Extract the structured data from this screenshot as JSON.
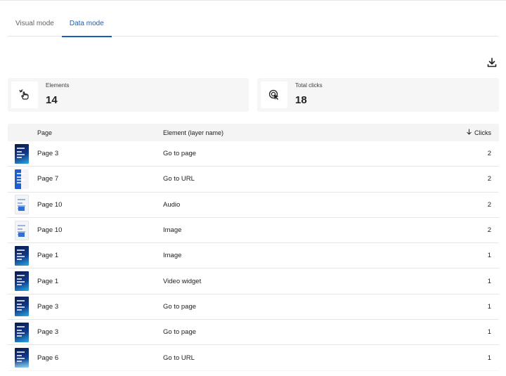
{
  "tabs": [
    {
      "label": "Visual mode",
      "active": false
    },
    {
      "label": "Data mode",
      "active": true
    }
  ],
  "download_icon": "download-icon",
  "stats": {
    "elements": {
      "label": "Elements",
      "value": "14",
      "icon": "tap-gesture-icon"
    },
    "total_clicks": {
      "label": "Total clicks",
      "value": "18",
      "icon": "click-cursor-icon"
    }
  },
  "table": {
    "headers": {
      "page": "Page",
      "element": "Element (layer name)",
      "clicks": "Clicks"
    },
    "sort": {
      "column": "clicks",
      "direction": "descending",
      "icon": "arrow-down-icon"
    },
    "rows": [
      {
        "thumb": "dark",
        "page": "Page 3",
        "element": "Go to page",
        "clicks": "2"
      },
      {
        "thumb": "dark-side",
        "page": "Page 7",
        "element": "Go to URL",
        "clicks": "2"
      },
      {
        "thumb": "light",
        "page": "Page 10",
        "element": "Audio",
        "clicks": "2"
      },
      {
        "thumb": "light",
        "page": "Page 10",
        "element": "Image",
        "clicks": "2"
      },
      {
        "thumb": "dark",
        "page": "Page 1",
        "element": "Image",
        "clicks": "1"
      },
      {
        "thumb": "dark",
        "page": "Page 1",
        "element": "Video widget",
        "clicks": "1"
      },
      {
        "thumb": "dark",
        "page": "Page 3",
        "element": "Go to page",
        "clicks": "1"
      },
      {
        "thumb": "dark",
        "page": "Page 3",
        "element": "Go to page",
        "clicks": "1"
      },
      {
        "thumb": "dark",
        "page": "Page 6",
        "element": "Go to URL",
        "clicks": "1"
      }
    ]
  },
  "colors": {
    "accent": "#1a5fb4",
    "card_bg": "#f6f6f6",
    "header_bg": "#f4f4f4"
  }
}
